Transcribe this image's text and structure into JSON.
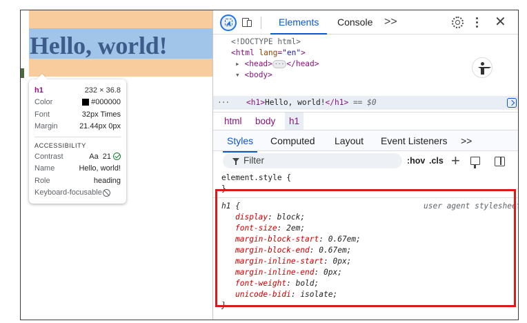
{
  "page": {
    "heading": "Hello, world!"
  },
  "tooltip": {
    "tag": "h1",
    "dimensions": "232 × 36.8",
    "rows": [
      {
        "key": "Color",
        "value": "#000000",
        "swatch": "#000000"
      },
      {
        "key": "Font",
        "value": "32px Times"
      },
      {
        "key": "Margin",
        "value": "21.44px 0px"
      }
    ],
    "accessibility_header": "ACCESSIBILITY",
    "a11y_rows": [
      {
        "key": "Contrast",
        "aa": "Aa",
        "value": "21"
      },
      {
        "key": "Name",
        "value": "Hello, world!"
      },
      {
        "key": "Role",
        "value": "heading"
      },
      {
        "key": "Keyboard-focusable",
        "value": ""
      }
    ]
  },
  "devtools": {
    "tabs": {
      "elements": "Elements",
      "console": "Console",
      "more": ">>"
    },
    "dom": {
      "doctype": "<!DOCTYPE html>",
      "html_open_tag": "<html",
      "html_attr": "lang",
      "html_attr_eq": "=",
      "html_attr_val": "\"en\"",
      "html_open_end": ">",
      "head_open": "<head>",
      "ellipsis": "···",
      "head_close": "</head>",
      "body_open": "<body>",
      "row_ellipsis": "···",
      "h1_open": "<h1>",
      "h1_text": "Hello, world!",
      "h1_close": "</h1>",
      "eq_marker": " == ",
      "dollar": "$0"
    },
    "breadcrumbs": [
      "html",
      "body",
      "h1"
    ],
    "subtabs": [
      "Styles",
      "Computed",
      "Layout",
      "Event Listeners",
      ">>"
    ],
    "filter_placeholder": "Filter",
    "filter_tools": {
      "hov": ":hov",
      "cls": ".cls"
    },
    "element_style": {
      "selector": "element.style {",
      "close": "}"
    },
    "ua_rule": {
      "selector": "h1 {",
      "source": "user agent stylesheet",
      "declarations": [
        {
          "prop": "display",
          "value": "block;"
        },
        {
          "prop": "font-size",
          "value": "2em;"
        },
        {
          "prop": "margin-block-start",
          "value": "0.67em;"
        },
        {
          "prop": "margin-block-end",
          "value": "0.67em;"
        },
        {
          "prop": "margin-inline-start",
          "value": "0px;"
        },
        {
          "prop": "margin-inline-end",
          "value": "0px;"
        },
        {
          "prop": "font-weight",
          "value": "bold;"
        },
        {
          "prop": "unicode-bidi",
          "value": "isolate;"
        }
      ],
      "close": "}"
    }
  },
  "colors": {
    "accent": "#0b57d0",
    "tag": "#881280",
    "highlight_border": "#d9191c",
    "margin_overlay": "#f9cc9d",
    "content_overlay": "#a0c5e8"
  }
}
